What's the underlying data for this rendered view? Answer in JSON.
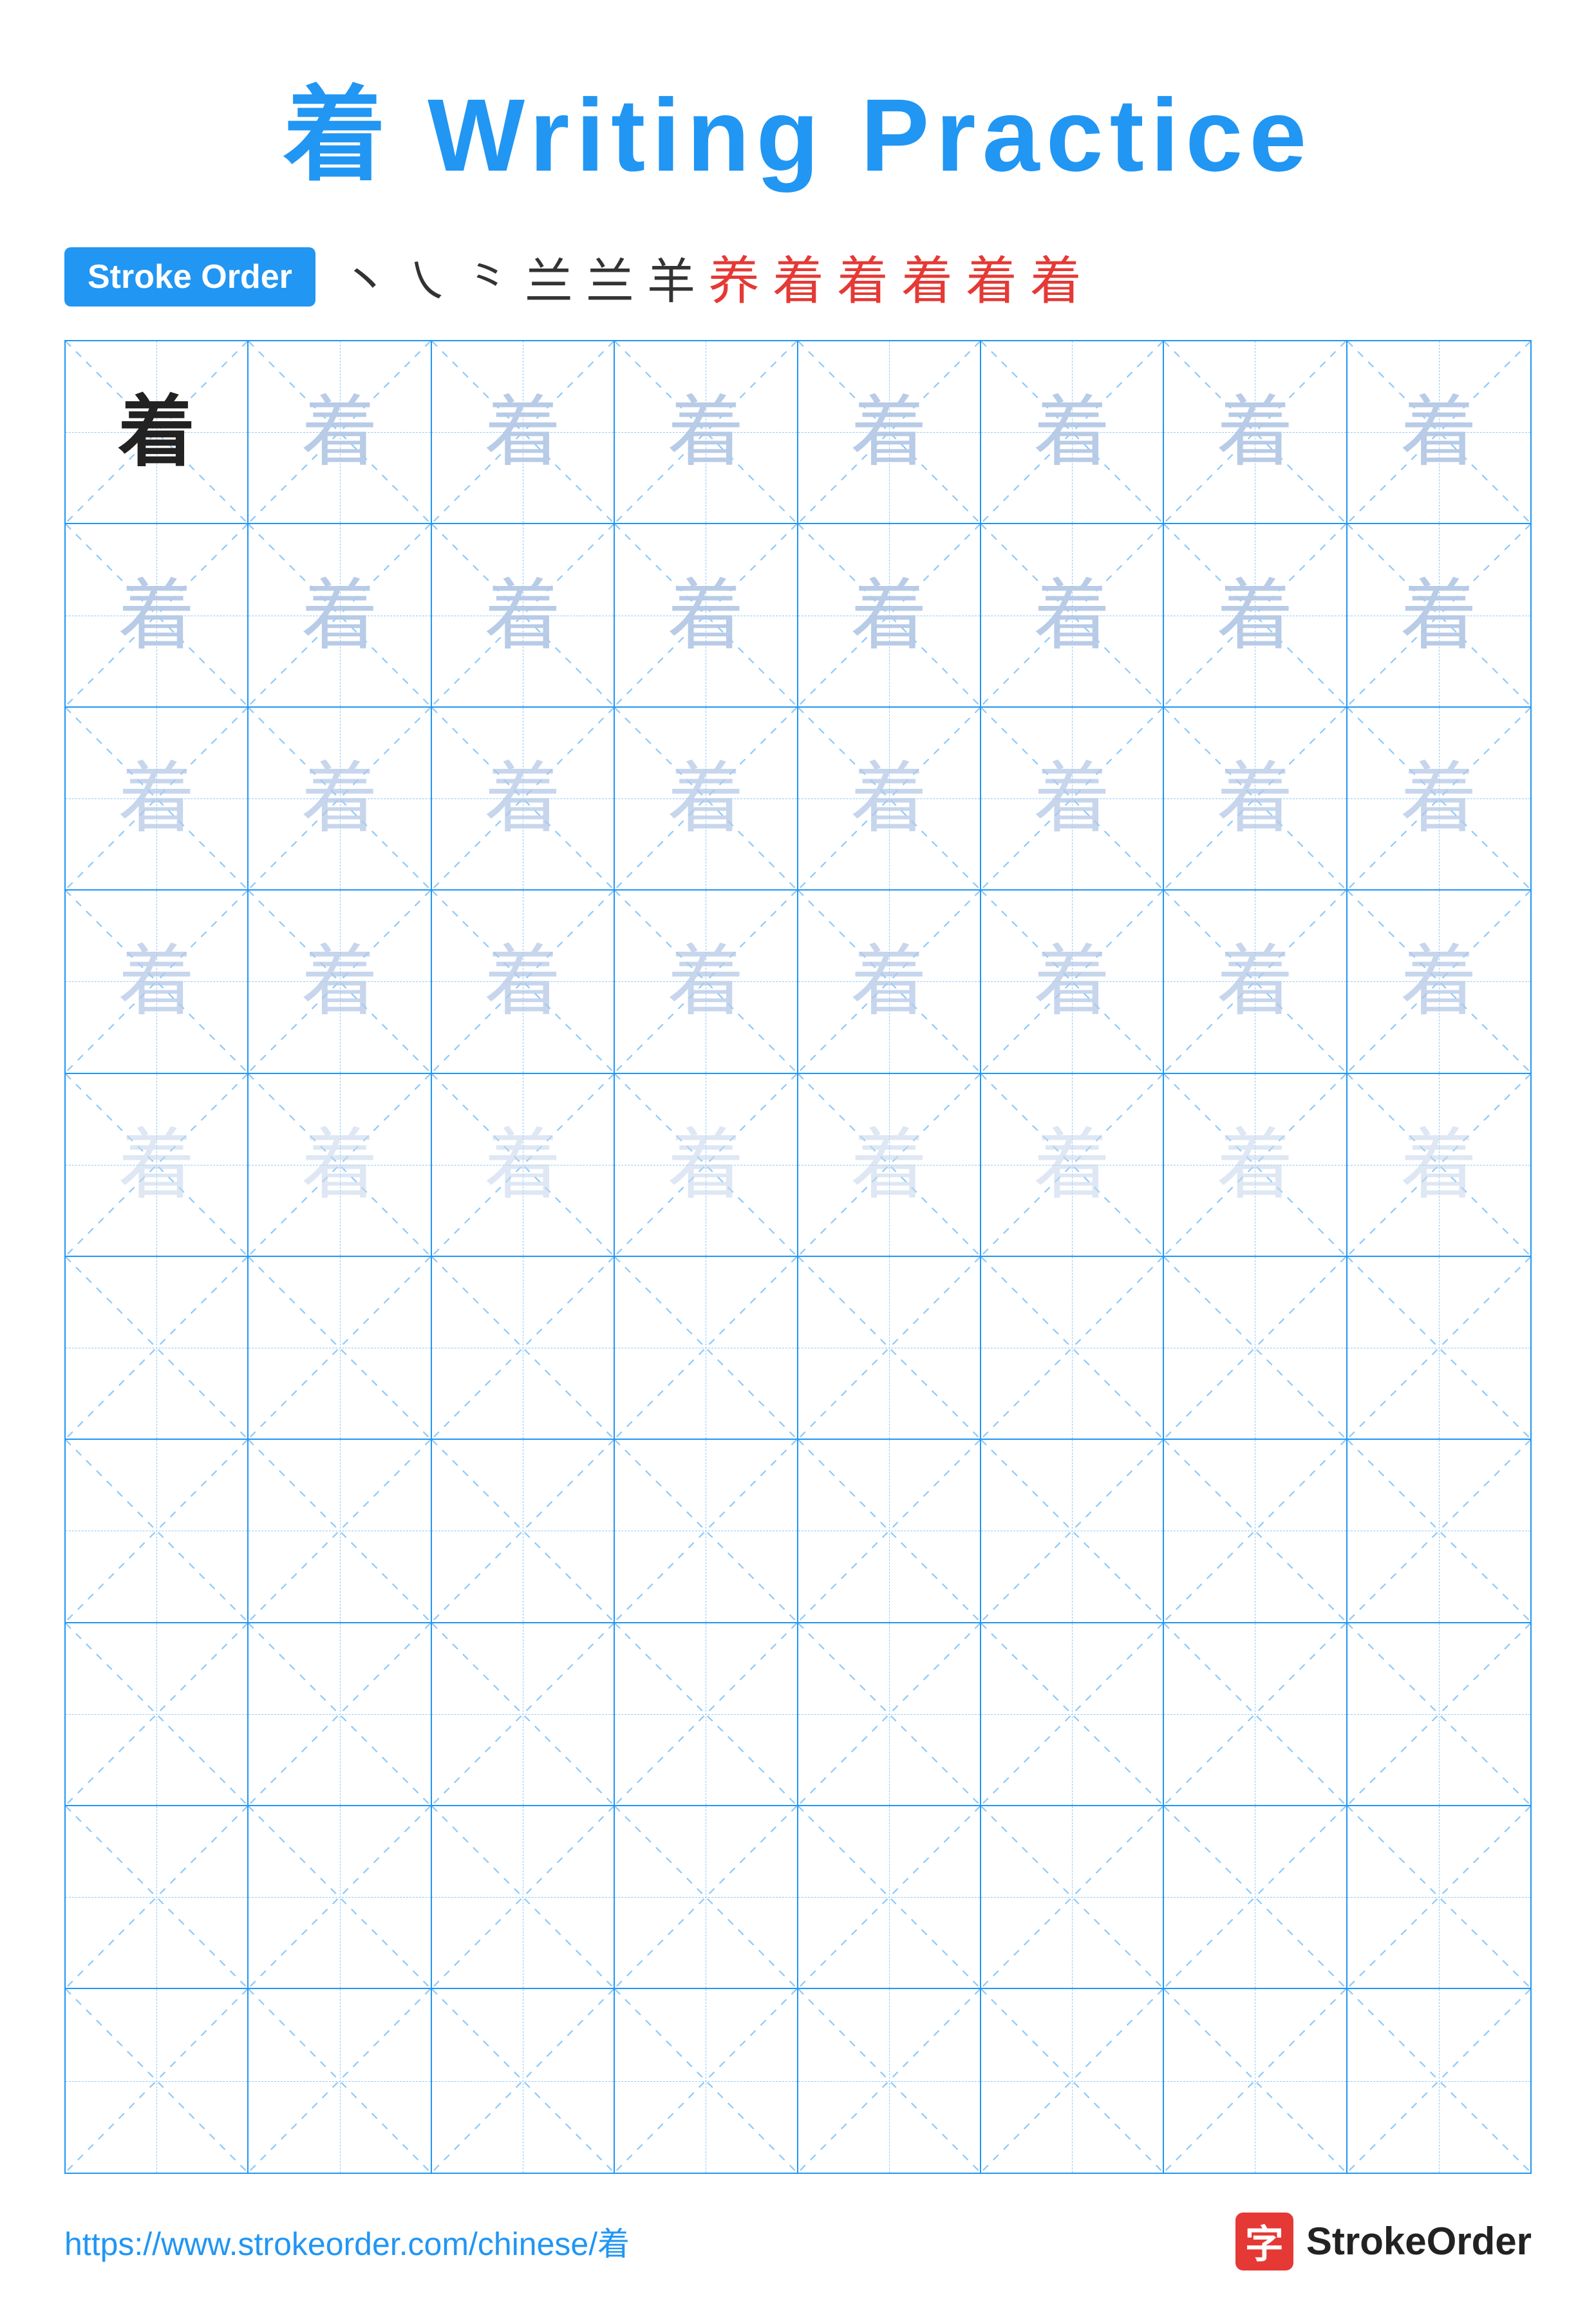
{
  "title": {
    "char": "着",
    "rest": " Writing Practice"
  },
  "stroke_order_badge": "Stroke Order",
  "stroke_steps": [
    {
      "text": "丶",
      "class": "s1"
    },
    {
      "text": "㇀",
      "class": "s2"
    },
    {
      "text": "⺀",
      "class": "s3"
    },
    {
      "text": "兰",
      "class": "s4"
    },
    {
      "text": "兰",
      "class": "s5"
    },
    {
      "text": "羊",
      "class": "s6"
    },
    {
      "text": "养",
      "class": "s7"
    },
    {
      "text": "着",
      "class": "s8"
    },
    {
      "text": "着",
      "class": "s9"
    },
    {
      "text": "着",
      "class": "s10"
    },
    {
      "text": "着",
      "class": "s11"
    }
  ],
  "grid": {
    "rows": 10,
    "cols": 8,
    "char": "着"
  },
  "footer": {
    "url": "https://www.strokeorder.com/chinese/着",
    "brand_char": "字",
    "brand_name": "StrokeOrder"
  }
}
